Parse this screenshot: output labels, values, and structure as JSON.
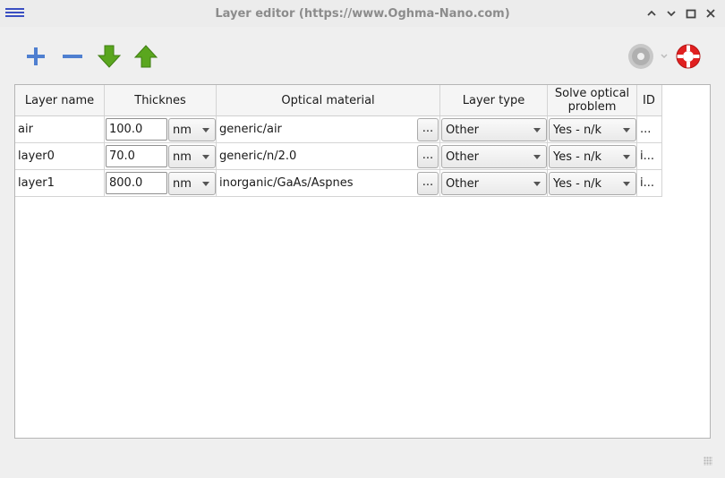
{
  "window": {
    "title": "Layer editor (https://www.Oghma-Nano.com)"
  },
  "toolbar": {
    "buttons": [
      "add-icon",
      "remove-icon",
      "move-down-icon",
      "move-up-icon",
      "optical-disc-icon",
      "help-lifebuoy-icon"
    ]
  },
  "table": {
    "headers": {
      "layer_name": "Layer name",
      "thickness": "Thicknes",
      "optical_material": "Optical material",
      "layer_type": "Layer type",
      "solve_line1": "Solve optical",
      "solve_line2": "problem",
      "id": "ID"
    },
    "rows": [
      {
        "name": "air",
        "thickness": "100.0",
        "unit": "nm",
        "material": "generic/air",
        "browse": "...",
        "type": "Other",
        "solve": "Yes - n/k",
        "id": "..."
      },
      {
        "name": "layer0",
        "thickness": "70.0",
        "unit": "nm",
        "material": "generic/n/2.0",
        "browse": "...",
        "type": "Other",
        "solve": "Yes - n/k",
        "id": "i..."
      },
      {
        "name": "layer1",
        "thickness": "800.0",
        "unit": "nm",
        "material": "inorganic/GaAs/Aspnes",
        "browse": "...",
        "type": "Other",
        "solve": "Yes - n/k",
        "id": "i..."
      }
    ]
  },
  "colors": {
    "accent_blue": "#3a4fc2",
    "arrow_green": "#5aa61e",
    "help_red": "#e02020"
  }
}
